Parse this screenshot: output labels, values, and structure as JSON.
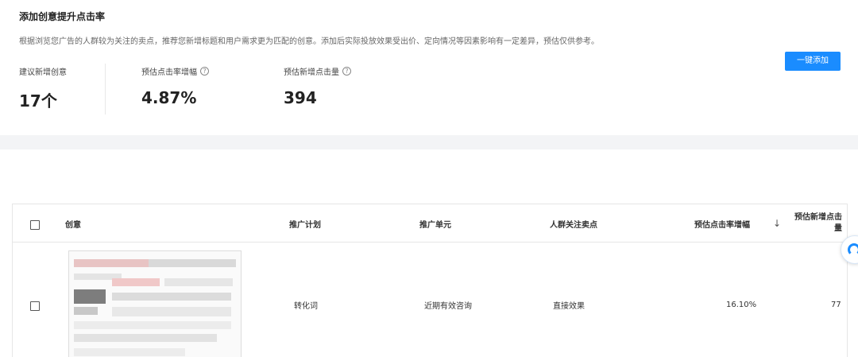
{
  "header": {
    "title": "添加创意提升点击率",
    "description": "根据浏览您广告的人群较为关注的卖点，推荐您新增标题和用户需求更为匹配的创意。添加后实际投放效果受出价、定向情况等因素影响有一定差异，预估仅供参考。",
    "add_button": "一键添加"
  },
  "stats": [
    {
      "label": "建议新增创意",
      "value": "17个"
    },
    {
      "label": "预估点击率增幅",
      "value": "4.87%"
    },
    {
      "label": "预估新增点击量",
      "value": "394"
    }
  ],
  "table": {
    "columns": [
      "创意",
      "推广计划",
      "推广单元",
      "人群关注卖点",
      "预估点击率增幅",
      "预估新增点击",
      "量"
    ],
    "sort_icon": "↓",
    "rows": [
      {
        "plan": "转化词",
        "unit": "近期有效咨询",
        "selling_point": "直接效果",
        "ctr_increase": "16.10%",
        "clicks": "77"
      }
    ]
  },
  "colors": {
    "accent": "#1a8cff",
    "band": "#f3f4f6"
  }
}
